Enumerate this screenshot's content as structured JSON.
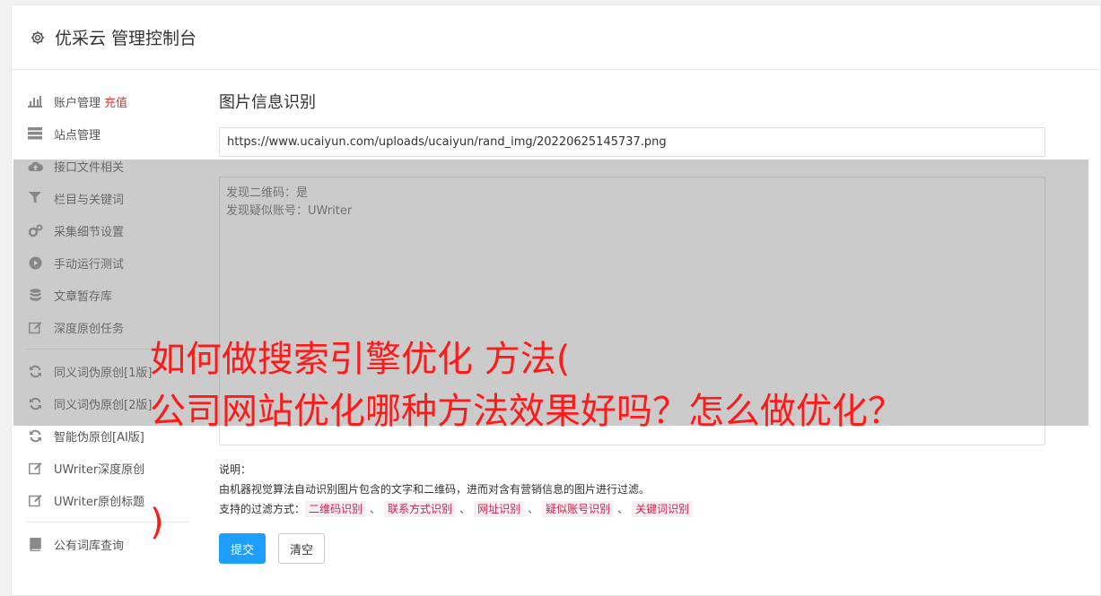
{
  "header": {
    "title": "优采云 管理控制台",
    "icon": "gear-icon"
  },
  "sidebar": {
    "items": [
      {
        "label": "账户管理",
        "badge": "充值",
        "icon": "bar-chart-icon"
      },
      {
        "label": "站点管理",
        "icon": "server-icon"
      },
      {
        "label": "接口文件相关",
        "icon": "cloud-upload-icon"
      },
      {
        "label": "栏目与关键词",
        "icon": "filter-icon"
      },
      {
        "label": "采集细节设置",
        "icon": "gears-icon"
      },
      {
        "label": "手动运行测试",
        "icon": "play-circle-icon"
      },
      {
        "label": "文章暂存库",
        "icon": "database-icon"
      },
      {
        "label": "深度原创任务",
        "icon": "edit-icon"
      }
    ],
    "items2": [
      {
        "label": "同义词伪原创[1版]",
        "icon": "refresh-icon"
      },
      {
        "label": "同义词伪原创[2版]",
        "icon": "refresh-icon"
      },
      {
        "label": "智能伪原创[AI版]",
        "icon": "refresh-icon"
      },
      {
        "label": "UWriter深度原创",
        "icon": "edit-icon"
      },
      {
        "label": "UWriter原创标题",
        "icon": "edit-icon"
      }
    ],
    "items3": [
      {
        "label": "公有词库查询",
        "icon": "book-icon"
      }
    ]
  },
  "main": {
    "title": "图片信息识别",
    "url_value": "https://www.ucaiyun.com/uploads/ucaiyun/rand_img/20220625145737.png",
    "result_lines": [
      "发现二维码：是",
      "发现疑似账号：UWriter"
    ],
    "desc_label": "说明：",
    "desc_text": "由机器视觉算法自动识别图片包含的文字和二维码，进而对含有营销信息的图片进行过滤。",
    "filter_label": "支持的过滤方式：",
    "filters": [
      "二维码识别",
      "联系方式识别",
      "网址识别",
      "疑似账号识别",
      "关键词识别"
    ],
    "filter_sep": "、",
    "submit_label": "提交",
    "clear_label": "清空"
  },
  "overlay": {
    "line1": "如何做搜索引擎优化 方法(",
    "line2": "公司网站优化哪种方法效果好吗？怎么做优化？",
    "line3": ")"
  },
  "colors": {
    "accent": "#1e9fff",
    "recharge": "#e4393c",
    "overlay_text": "#ff1a1a",
    "tag_text": "#c7254e",
    "tag_bg": "#f8f0f3"
  }
}
